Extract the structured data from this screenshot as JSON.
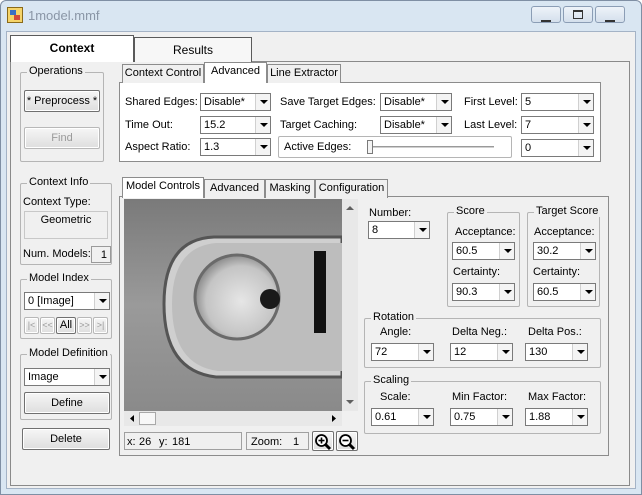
{
  "window": {
    "title": "1model.mmf"
  },
  "main_tabs": [
    {
      "label": "Context"
    },
    {
      "label": "Results"
    }
  ],
  "operations": {
    "title": "Operations",
    "preprocess_label": "* Preprocess *",
    "find_label": "Find"
  },
  "context_info": {
    "title": "Context Info",
    "type_label": "Context Type:",
    "type_value": "Geometric",
    "num_models_label": "Num. Models:",
    "num_models_value": "1"
  },
  "model_index": {
    "title": "Model Index",
    "selected": "0 [Image]",
    "nav": [
      "|<",
      "<<",
      "All",
      ">>",
      ">|"
    ]
  },
  "model_definition": {
    "title": "Model Definition",
    "selected": "Image",
    "define_label": "Define",
    "delete_label": "Delete"
  },
  "context_tabs": [
    {
      "label": "Context Control"
    },
    {
      "label": "Advanced"
    },
    {
      "label": "Line Extractor"
    }
  ],
  "advanced": {
    "shared_edges_label": "Shared Edges:",
    "shared_edges_value": "Disable*",
    "time_out_label": "Time Out:",
    "time_out_value": "15.2",
    "aspect_ratio_label": "Aspect Ratio:",
    "aspect_ratio_value": "1.3",
    "save_target_edges_label": "Save Target Edges:",
    "save_target_edges_value": "Disable*",
    "target_caching_label": "Target Caching:",
    "target_caching_value": "Disable*",
    "active_edges_label": "Active Edges:",
    "active_edges_value": "0",
    "active_edges_slider": 0.0,
    "first_level_label": "First Level:",
    "first_level_value": "5",
    "last_level_label": "Last Level:",
    "last_level_value": "7"
  },
  "model_tabs": [
    {
      "label": "Model Controls"
    },
    {
      "label": "Advanced"
    },
    {
      "label": "Masking"
    },
    {
      "label": "Configuration"
    }
  ],
  "model_controls": {
    "number_label": "Number:",
    "number_value": "8",
    "score": {
      "title": "Score",
      "acceptance_label": "Acceptance:",
      "acceptance_value": "60.5",
      "certainty_label": "Certainty:",
      "certainty_value": "90.3"
    },
    "target_score": {
      "title": "Target Score",
      "acceptance_label": "Acceptance:",
      "acceptance_value": "30.2",
      "certainty_label": "Certainty:",
      "certainty_value": "60.5"
    },
    "rotation": {
      "title": "Rotation",
      "angle_label": "Angle:",
      "angle_value": "72",
      "delta_neg_label": "Delta Neg.:",
      "delta_neg_value": "12",
      "delta_pos_label": "Delta Pos.:",
      "delta_pos_value": "130"
    },
    "scaling": {
      "title": "Scaling",
      "scale_label": "Scale:",
      "scale_value": "0.61",
      "min_factor_label": "Min Factor:",
      "min_factor_value": "0.75",
      "max_factor_label": "Max Factor:",
      "max_factor_value": "1.88"
    }
  },
  "viewer": {
    "x_label": "x:",
    "x_value": "26",
    "y_label": "y:",
    "y_value": "181",
    "zoom_label": "Zoom:",
    "zoom_value": "1"
  },
  "colors": {
    "window_frame": "#d9e6f2",
    "panel": "#f0f0f0",
    "image_bg": "#8c8c8c"
  }
}
